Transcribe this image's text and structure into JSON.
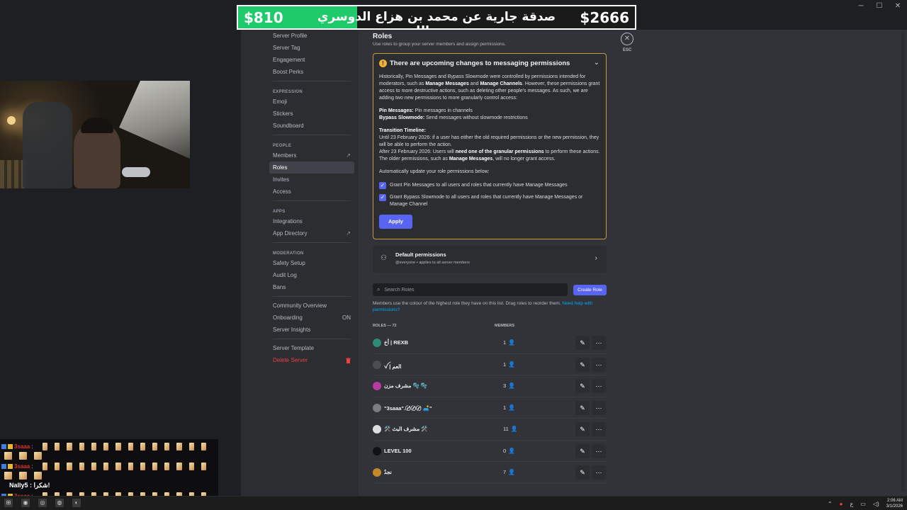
{
  "window": {
    "minimize": "─",
    "maximize": "☐",
    "close": "✕"
  },
  "banner": {
    "left_amount": "$810",
    "text": "صدقة جارية عن محمد بن هزاع الدوسري رحمه الله",
    "right_amount": "$2666",
    "progress": 0.3
  },
  "chat": {
    "lines": [
      {
        "user": "3saaa",
        "sep": ":"
      },
      {
        "user": "3saaa",
        "sep": ":"
      },
      {
        "user": "3saaa",
        "sep": ":"
      }
    ],
    "nally": "Nally5 : شكرا!"
  },
  "sidebar": {
    "items_top": [
      {
        "label": "Server Profile"
      },
      {
        "label": "Server Tag"
      },
      {
        "label": "Engagement"
      },
      {
        "label": "Boost Perks"
      }
    ],
    "expression_heading": "EXPRESSION",
    "expression": [
      {
        "label": "Emoji"
      },
      {
        "label": "Stickers"
      },
      {
        "label": "Soundboard"
      }
    ],
    "people_heading": "PEOPLE",
    "people": [
      {
        "label": "Members",
        "ext": "↗"
      },
      {
        "label": "Roles"
      },
      {
        "label": "Invites"
      },
      {
        "label": "Access"
      }
    ],
    "apps_heading": "APPS",
    "apps": [
      {
        "label": "Integrations"
      },
      {
        "label": "App Directory",
        "ext": "↗"
      }
    ],
    "moderation_heading": "MODERATION",
    "moderation": [
      {
        "label": "Safety Setup"
      },
      {
        "label": "Audit Log"
      },
      {
        "label": "Bans"
      }
    ],
    "community": [
      {
        "label": "Community Overview"
      },
      {
        "label": "Onboarding",
        "status": "ON"
      },
      {
        "label": "Server Insights"
      }
    ],
    "template": {
      "label": "Server Template"
    },
    "delete": {
      "label": "Delete Server",
      "icon": "trash-icon"
    }
  },
  "main": {
    "title": "Roles",
    "subtitle": "Use roles to group your server members and assign permissions.",
    "notice": {
      "title": "There are upcoming changes to messaging permissions",
      "p1_a": "Historically, Pin Messages and Bypass Slowmode were controlled by permissions intended for moderators, such as ",
      "p1_b": "Manage Messages",
      "p1_c": " and ",
      "p1_d": "Manage Channels",
      "p1_e": ". However, these permissions grant access to more destructive actions, such as deleting other people's messages. As such, we are adding two new permissions to more granularly control access:",
      "pin_label": "Pin Messages:",
      "pin_desc": " Pin messages in channels",
      "bypass_label": "Bypass Slowmode:",
      "bypass_desc": " Send messages without slowmode restrictions",
      "timeline_label": "Transition Timeline:",
      "timeline_1": "Until 23 February 2026: if a user has either the old required permissions or the new permission, they will be able to perform the action.",
      "timeline_2a": "After 23 February 2026: Users will ",
      "timeline_2b": "need one of the granular permissions",
      "timeline_2c": " to perform these actions. The older permissions, such as ",
      "timeline_2d": "Manage Messages",
      "timeline_2e": ", will no longer grant access.",
      "auto": "Automatically update your role permissions below:",
      "check1": "Grant Pin Messages to all users and roles that currently have Manage Messages",
      "check2": "Grant Bypass Slowmode to all users and roles that currently have Manage Messages or Manage Channel",
      "apply": "Apply"
    },
    "default_perms": {
      "title": "Default permissions",
      "sub": "@everyone • applies to all server members"
    },
    "search": {
      "placeholder": "Search Roles"
    },
    "create": "Create Role",
    "hint": "Members use the colour of the highest role they have on this list. Drag roles to reorder them.",
    "hint_link": "Need help with permissions?",
    "table": {
      "roles_header": "ROLES — 72",
      "members_header": "MEMBERS"
    },
    "roles": [
      {
        "name": "أخ | REXB",
        "count": "1",
        "color": "#2e8b7a"
      },
      {
        "name": "ꪜ | العم",
        "count": "1",
        "color": "#4a4d52"
      },
      {
        "name": "مشرف مزن 🫧 🫧",
        "count": "3",
        "color": "#b53d9e"
      },
      {
        "name": "\"3saaa\".〄〄〄 🛋️\"",
        "count": "1",
        "color": "#7a7d82"
      },
      {
        "name": "🛠️  مشرف البث  🛠️",
        "count": "11",
        "color": "#dbdee1"
      },
      {
        "name": "LEVEL 100",
        "count": "0",
        "color": "#111214"
      },
      {
        "name": "نجدُ",
        "count": "7",
        "color": "#c48a2a"
      }
    ]
  },
  "esc_label": "ESC",
  "tray": {
    "time": "2:06 AM",
    "date": "3/1/2026",
    "lang": "ع"
  }
}
